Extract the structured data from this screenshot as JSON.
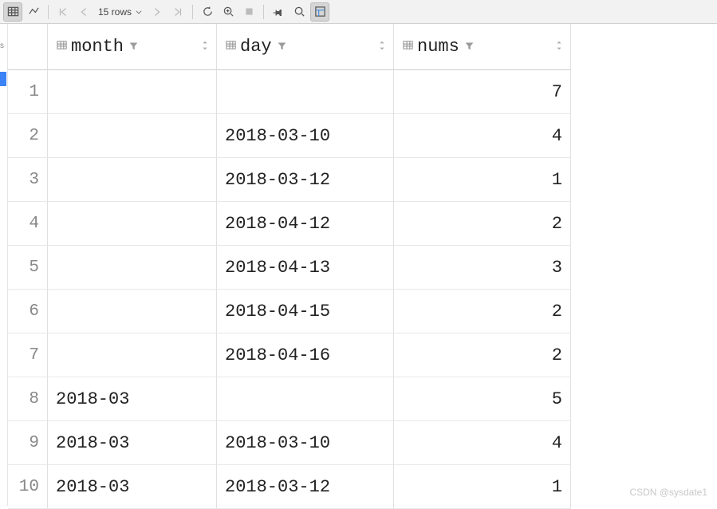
{
  "toolbar": {
    "rows_label": "15 rows"
  },
  "columns": [
    {
      "name": "month"
    },
    {
      "name": "day"
    },
    {
      "name": "nums"
    }
  ],
  "rows": [
    {
      "n": "1",
      "month": null,
      "day": null,
      "nums": "7"
    },
    {
      "n": "2",
      "month": null,
      "day": "2018-03-10",
      "nums": "4"
    },
    {
      "n": "3",
      "month": null,
      "day": "2018-03-12",
      "nums": "1"
    },
    {
      "n": "4",
      "month": null,
      "day": "2018-04-12",
      "nums": "2"
    },
    {
      "n": "5",
      "month": null,
      "day": "2018-04-13",
      "nums": "3"
    },
    {
      "n": "6",
      "month": null,
      "day": "2018-04-15",
      "nums": "2"
    },
    {
      "n": "7",
      "month": null,
      "day": "2018-04-16",
      "nums": "2"
    },
    {
      "n": "8",
      "month": "2018-03",
      "day": null,
      "nums": "5"
    },
    {
      "n": "9",
      "month": "2018-03",
      "day": "2018-03-10",
      "nums": "4"
    },
    {
      "n": "10",
      "month": "2018-03",
      "day": "2018-03-12",
      "nums": "1"
    }
  ],
  "null_display": "<null>",
  "watermark": "CSDN @sysdate1",
  "edge_label": "s"
}
